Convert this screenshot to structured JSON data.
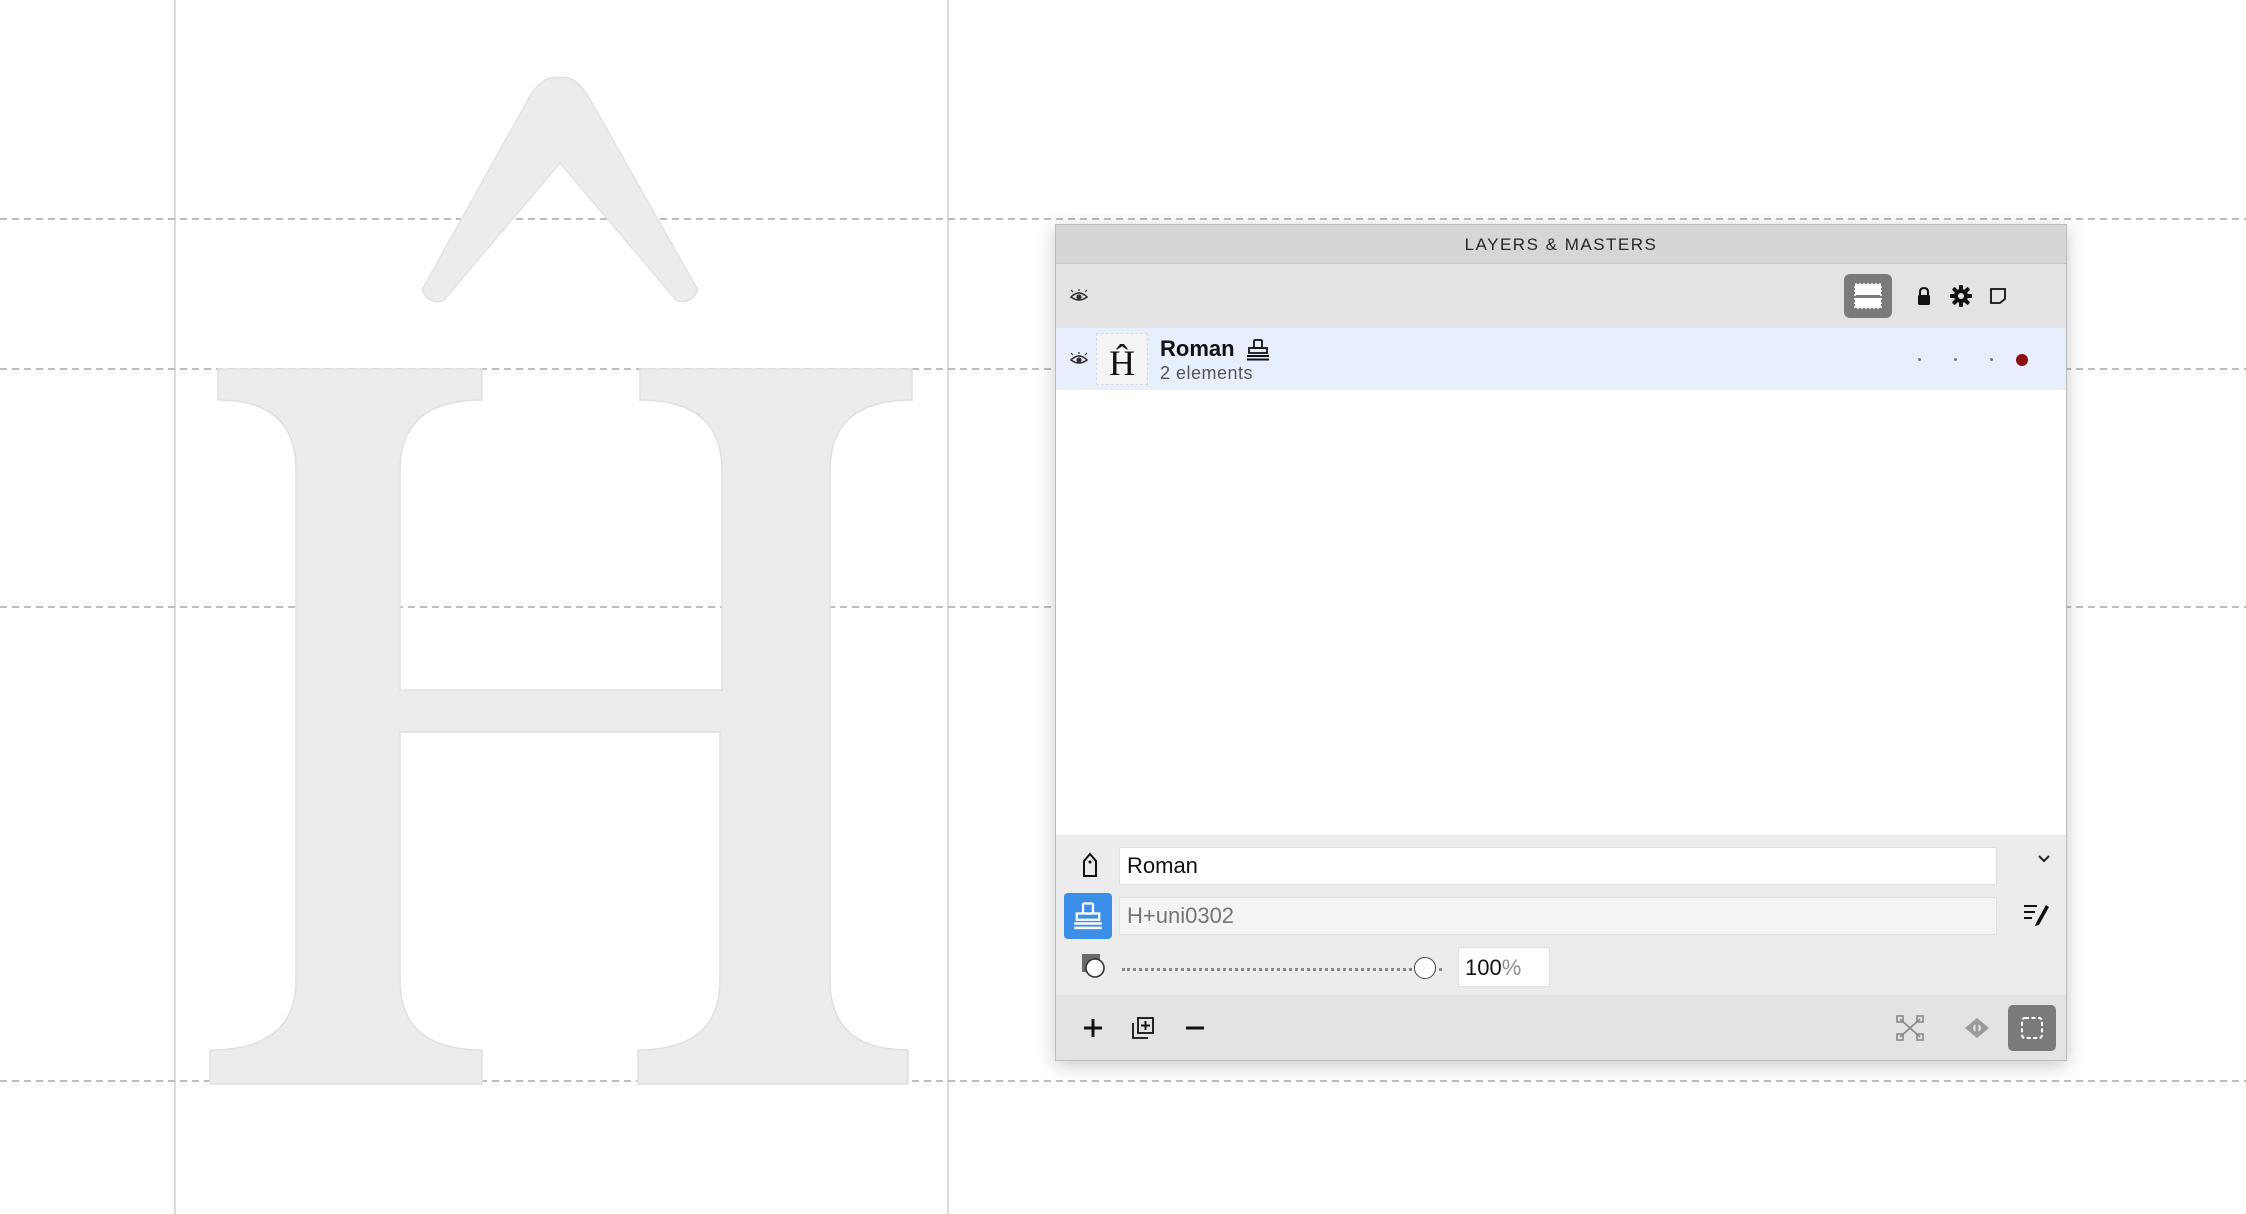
{
  "panel": {
    "title": "LAYERS & MASTERS"
  },
  "layer": {
    "glyph": "Ĥ",
    "name": "Roman",
    "subtitle": "2 elements"
  },
  "properties": {
    "master_name": "Roman",
    "layer_name_placeholder": "H+uni0302",
    "opacity_value": "100",
    "opacity_unit": "%",
    "opacity_fraction": 1.0
  },
  "colors": {
    "accent": "#3b8fe8",
    "selected_row": "#e8effc",
    "master_color_dot": "#8a0f0f",
    "glyph_fill": "#ececec"
  },
  "icons": {
    "visibility": "eye-icon",
    "master": "master-stack-icon",
    "lock": "lock-icon",
    "settings": "gear-icon",
    "layer-view": "layer-view-icon",
    "add": "plus-icon",
    "duplicate": "duplicate-icon",
    "remove": "minus-icon"
  }
}
